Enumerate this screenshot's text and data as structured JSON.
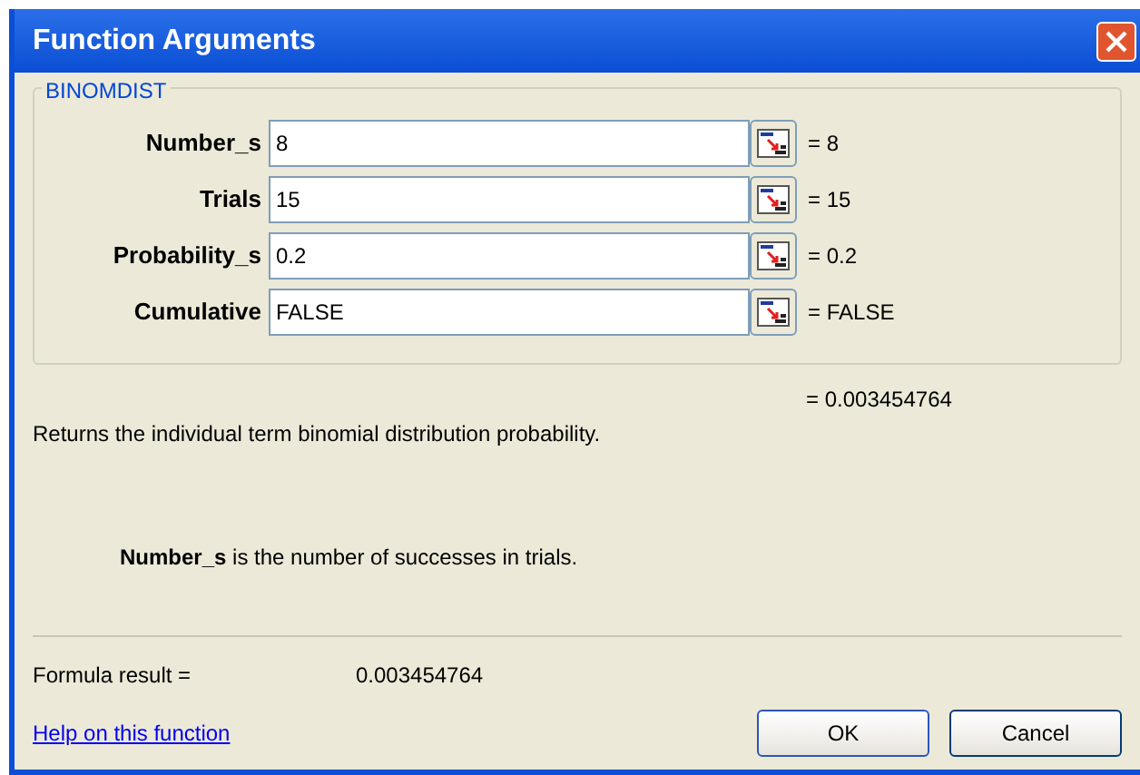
{
  "window": {
    "title": "Function Arguments"
  },
  "group": {
    "title": "BINOMDIST"
  },
  "arguments": [
    {
      "label": "Number_s",
      "value": "8",
      "result": "= 8"
    },
    {
      "label": "Trials",
      "value": "15",
      "result": "= 15"
    },
    {
      "label": "Probability_s",
      "value": "0.2",
      "result": "= 0.2"
    },
    {
      "label": "Cumulative",
      "value": "FALSE",
      "result": "= FALSE"
    }
  ],
  "function_result": "= 0.003454764",
  "description": "Returns the individual term binomial distribution probability.",
  "argument_help": "**Number_s** is the number of successes in trials.",
  "formula_result": {
    "label": "Formula result =",
    "value": "0.003454764"
  },
  "help_link": "Help on this function",
  "buttons": [
    "OK",
    "Cancel"
  ]
}
